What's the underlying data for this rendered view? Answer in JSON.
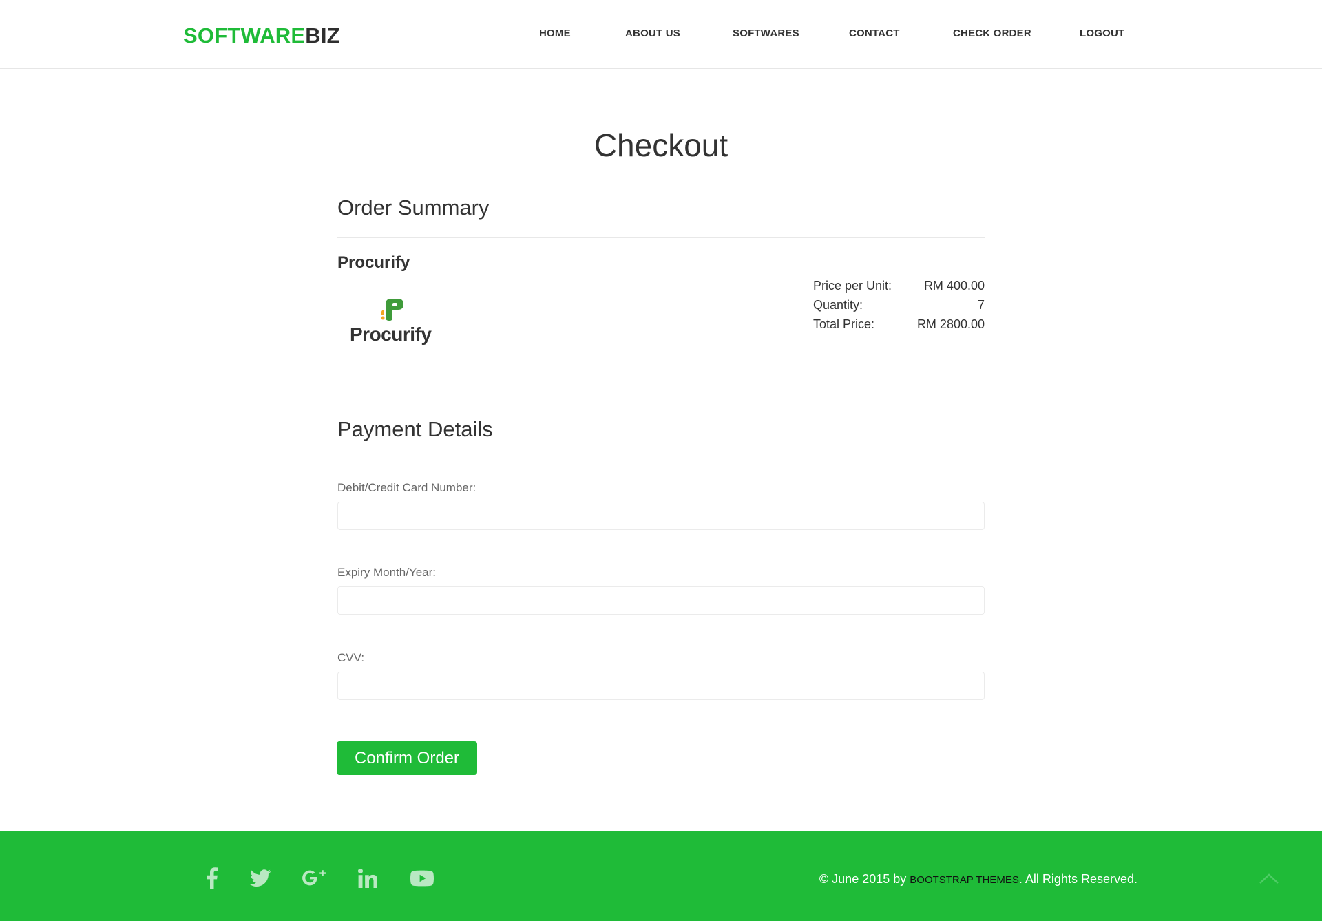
{
  "header": {
    "brand_part1": "SOFTWARE",
    "brand_part2": "BIZ",
    "nav": [
      "HOME",
      "ABOUT US",
      "SOFTWARES",
      "CONTACT",
      "CHECK ORDER",
      "LOGOUT"
    ]
  },
  "main": {
    "title": "Checkout",
    "order_summary": {
      "heading": "Order Summary",
      "product_name": "Procurify",
      "product_logo_text": "Procurify",
      "price_label": "Price per Unit:",
      "price_value": "RM 400.00",
      "quantity_label": "Quantity:",
      "quantity_value": "7",
      "total_label": "Total Price:",
      "total_value": "RM 2800.00"
    },
    "payment": {
      "heading": "Payment Details",
      "card_label": "Debit/Credit Card Number:",
      "card_value": "",
      "expiry_label": "Expiry Month/Year:",
      "expiry_value": "",
      "cvv_label": "CVV:",
      "cvv_value": "",
      "confirm_label": "Confirm Order"
    }
  },
  "footer": {
    "social_icons": [
      "facebook-icon",
      "twitter-icon",
      "google-plus-icon",
      "linkedin-icon",
      "youtube-icon"
    ],
    "copyright_prefix": "© June 2015 by ",
    "credit_link": "BOOTSTRAP THEMES",
    "copyright_suffix": ". All Rights Reserved."
  },
  "colors": {
    "accent": "#1fbb38",
    "logo_green": "#3f9b3a",
    "logo_orange": "#f5a623"
  }
}
